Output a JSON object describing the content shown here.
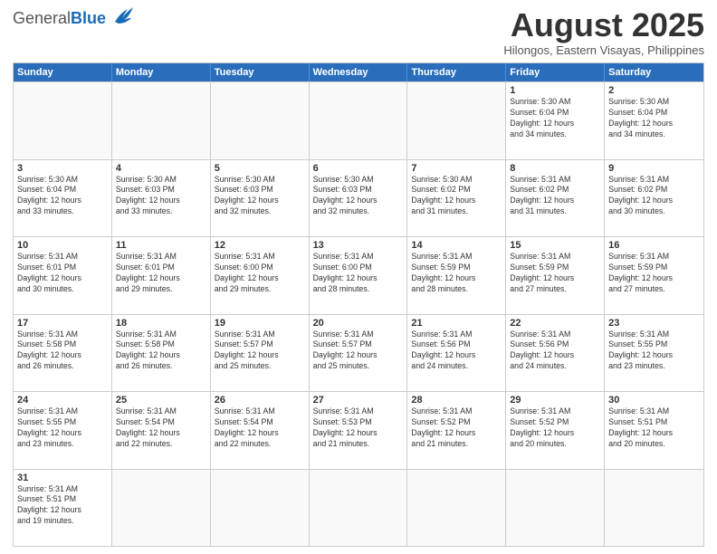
{
  "header": {
    "logo_general": "General",
    "logo_blue": "Blue",
    "title": "August 2025",
    "subtitle": "Hilongos, Eastern Visayas, Philippines"
  },
  "weekdays": [
    "Sunday",
    "Monday",
    "Tuesday",
    "Wednesday",
    "Thursday",
    "Friday",
    "Saturday"
  ],
  "weeks": [
    [
      {
        "day": "",
        "info": ""
      },
      {
        "day": "",
        "info": ""
      },
      {
        "day": "",
        "info": ""
      },
      {
        "day": "",
        "info": ""
      },
      {
        "day": "",
        "info": ""
      },
      {
        "day": "1",
        "info": "Sunrise: 5:30 AM\nSunset: 6:04 PM\nDaylight: 12 hours\nand 34 minutes."
      },
      {
        "day": "2",
        "info": "Sunrise: 5:30 AM\nSunset: 6:04 PM\nDaylight: 12 hours\nand 34 minutes."
      }
    ],
    [
      {
        "day": "3",
        "info": "Sunrise: 5:30 AM\nSunset: 6:04 PM\nDaylight: 12 hours\nand 33 minutes."
      },
      {
        "day": "4",
        "info": "Sunrise: 5:30 AM\nSunset: 6:03 PM\nDaylight: 12 hours\nand 33 minutes."
      },
      {
        "day": "5",
        "info": "Sunrise: 5:30 AM\nSunset: 6:03 PM\nDaylight: 12 hours\nand 32 minutes."
      },
      {
        "day": "6",
        "info": "Sunrise: 5:30 AM\nSunset: 6:03 PM\nDaylight: 12 hours\nand 32 minutes."
      },
      {
        "day": "7",
        "info": "Sunrise: 5:30 AM\nSunset: 6:02 PM\nDaylight: 12 hours\nand 31 minutes."
      },
      {
        "day": "8",
        "info": "Sunrise: 5:31 AM\nSunset: 6:02 PM\nDaylight: 12 hours\nand 31 minutes."
      },
      {
        "day": "9",
        "info": "Sunrise: 5:31 AM\nSunset: 6:02 PM\nDaylight: 12 hours\nand 30 minutes."
      }
    ],
    [
      {
        "day": "10",
        "info": "Sunrise: 5:31 AM\nSunset: 6:01 PM\nDaylight: 12 hours\nand 30 minutes."
      },
      {
        "day": "11",
        "info": "Sunrise: 5:31 AM\nSunset: 6:01 PM\nDaylight: 12 hours\nand 29 minutes."
      },
      {
        "day": "12",
        "info": "Sunrise: 5:31 AM\nSunset: 6:00 PM\nDaylight: 12 hours\nand 29 minutes."
      },
      {
        "day": "13",
        "info": "Sunrise: 5:31 AM\nSunset: 6:00 PM\nDaylight: 12 hours\nand 28 minutes."
      },
      {
        "day": "14",
        "info": "Sunrise: 5:31 AM\nSunset: 5:59 PM\nDaylight: 12 hours\nand 28 minutes."
      },
      {
        "day": "15",
        "info": "Sunrise: 5:31 AM\nSunset: 5:59 PM\nDaylight: 12 hours\nand 27 minutes."
      },
      {
        "day": "16",
        "info": "Sunrise: 5:31 AM\nSunset: 5:59 PM\nDaylight: 12 hours\nand 27 minutes."
      }
    ],
    [
      {
        "day": "17",
        "info": "Sunrise: 5:31 AM\nSunset: 5:58 PM\nDaylight: 12 hours\nand 26 minutes."
      },
      {
        "day": "18",
        "info": "Sunrise: 5:31 AM\nSunset: 5:58 PM\nDaylight: 12 hours\nand 26 minutes."
      },
      {
        "day": "19",
        "info": "Sunrise: 5:31 AM\nSunset: 5:57 PM\nDaylight: 12 hours\nand 25 minutes."
      },
      {
        "day": "20",
        "info": "Sunrise: 5:31 AM\nSunset: 5:57 PM\nDaylight: 12 hours\nand 25 minutes."
      },
      {
        "day": "21",
        "info": "Sunrise: 5:31 AM\nSunset: 5:56 PM\nDaylight: 12 hours\nand 24 minutes."
      },
      {
        "day": "22",
        "info": "Sunrise: 5:31 AM\nSunset: 5:56 PM\nDaylight: 12 hours\nand 24 minutes."
      },
      {
        "day": "23",
        "info": "Sunrise: 5:31 AM\nSunset: 5:55 PM\nDaylight: 12 hours\nand 23 minutes."
      }
    ],
    [
      {
        "day": "24",
        "info": "Sunrise: 5:31 AM\nSunset: 5:55 PM\nDaylight: 12 hours\nand 23 minutes."
      },
      {
        "day": "25",
        "info": "Sunrise: 5:31 AM\nSunset: 5:54 PM\nDaylight: 12 hours\nand 22 minutes."
      },
      {
        "day": "26",
        "info": "Sunrise: 5:31 AM\nSunset: 5:54 PM\nDaylight: 12 hours\nand 22 minutes."
      },
      {
        "day": "27",
        "info": "Sunrise: 5:31 AM\nSunset: 5:53 PM\nDaylight: 12 hours\nand 21 minutes."
      },
      {
        "day": "28",
        "info": "Sunrise: 5:31 AM\nSunset: 5:52 PM\nDaylight: 12 hours\nand 21 minutes."
      },
      {
        "day": "29",
        "info": "Sunrise: 5:31 AM\nSunset: 5:52 PM\nDaylight: 12 hours\nand 20 minutes."
      },
      {
        "day": "30",
        "info": "Sunrise: 5:31 AM\nSunset: 5:51 PM\nDaylight: 12 hours\nand 20 minutes."
      }
    ],
    [
      {
        "day": "31",
        "info": "Sunrise: 5:31 AM\nSunset: 5:51 PM\nDaylight: 12 hours\nand 19 minutes."
      },
      {
        "day": "",
        "info": ""
      },
      {
        "day": "",
        "info": ""
      },
      {
        "day": "",
        "info": ""
      },
      {
        "day": "",
        "info": ""
      },
      {
        "day": "",
        "info": ""
      },
      {
        "day": "",
        "info": ""
      }
    ]
  ]
}
